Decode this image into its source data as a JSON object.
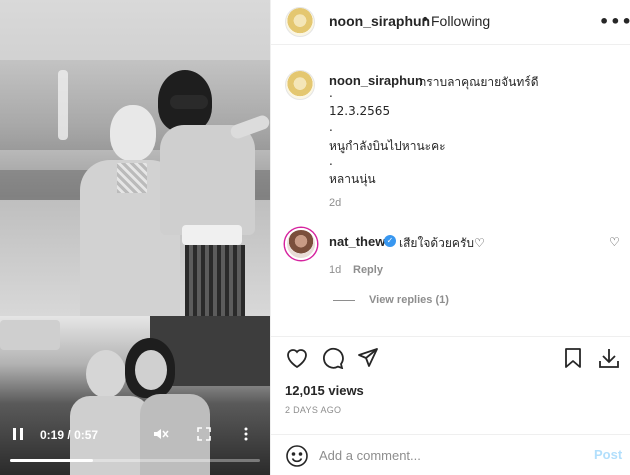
{
  "header": {
    "username": "noon_siraphun",
    "separator": "•",
    "follow_status": "Following",
    "more_icon": "more-horizontal-icon"
  },
  "caption": {
    "username": "noon_siraphun",
    "lines": [
      "กราบลาคุณยายจันทร์ดี",
      ".",
      "12.3.2565",
      ".",
      "หนูกำลังบินไปหานะคะ",
      ".",
      "หลานนุ่น"
    ],
    "time": "2d"
  },
  "comment": {
    "username": "nat_thew",
    "text": "เสียใจด้วยครับ♡",
    "time": "1d",
    "reply_label": "Reply",
    "view_replies_label": "View replies (1)"
  },
  "video": {
    "current_time": "0:19",
    "separator": "/",
    "duration": "0:57",
    "progress": 0.333
  },
  "stats": {
    "views": "12,015 views",
    "posted": "2 DAYS AGO"
  },
  "add_comment": {
    "placeholder": "Add a comment...",
    "post_label": "Post"
  },
  "colors": {
    "text": "#262626",
    "muted": "#8e8e8e",
    "verified": "#3897f0",
    "post_disabled": "#b2dffc"
  }
}
